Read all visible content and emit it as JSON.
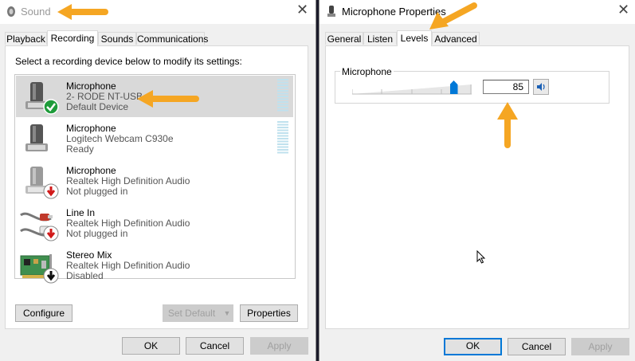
{
  "sound": {
    "title": "Sound",
    "tabs": [
      {
        "label": "Playback"
      },
      {
        "label": "Recording"
      },
      {
        "label": "Sounds"
      },
      {
        "label": "Communications"
      }
    ],
    "instruction": "Select a recording device below to modify its settings:",
    "devices": [
      {
        "name": "Microphone",
        "line2": "2- RODE NT-USB",
        "line3": "Default Device",
        "icon": "microphone-icon",
        "status": "default-check"
      },
      {
        "name": "Microphone",
        "line2": "Logitech Webcam C930e",
        "line3": "Ready",
        "icon": "microphone-icon",
        "status": "none"
      },
      {
        "name": "Microphone",
        "line2": "Realtek High Definition Audio",
        "line3": "Not plugged in",
        "icon": "microphone-icon",
        "status": "unplugged"
      },
      {
        "name": "Line In",
        "line2": "Realtek High Definition Audio",
        "line3": "Not plugged in",
        "icon": "line-in-cable-icon",
        "status": "unplugged"
      },
      {
        "name": "Stereo Mix",
        "line2": "Realtek High Definition Audio",
        "line3": "Disabled",
        "icon": "sound-card-icon",
        "status": "disabled"
      }
    ],
    "buttons": {
      "configure": "Configure",
      "set_default": "Set Default",
      "properties": "Properties",
      "ok": "OK",
      "cancel": "Cancel",
      "apply": "Apply"
    }
  },
  "properties": {
    "title": "Microphone Properties",
    "tabs": [
      {
        "label": "General"
      },
      {
        "label": "Listen"
      },
      {
        "label": "Levels"
      },
      {
        "label": "Advanced"
      }
    ],
    "active_tab": "Levels",
    "group_label": "Microphone",
    "level_value": "85",
    "buttons": {
      "ok": "OK",
      "cancel": "Cancel",
      "apply": "Apply"
    }
  },
  "colors": {
    "annotation_arrow": "#f5a623",
    "accent": "#0078d7",
    "check_green": "#1e9b3a",
    "unplugged_red": "#d11a1a"
  }
}
